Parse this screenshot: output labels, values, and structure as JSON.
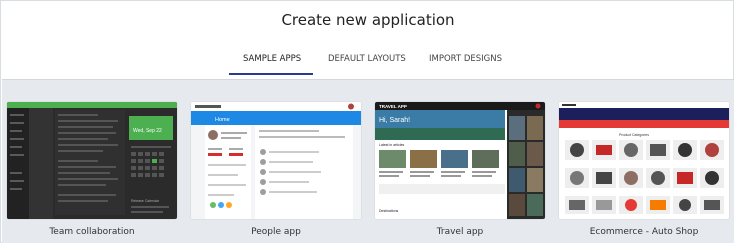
{
  "page": {
    "title": "Create new application"
  },
  "tabs": [
    {
      "label": "SAMPLE APPS",
      "active": true
    },
    {
      "label": "DEFAULT LAYOUTS",
      "active": false
    },
    {
      "label": "IMPORT DESIGNS",
      "active": false
    }
  ],
  "apps": [
    {
      "caption": "Team collaboration",
      "screen": {
        "date_label": "Wed, Sep 22",
        "calendar_label": "Release Calendar"
      }
    },
    {
      "caption": "People app",
      "screen": {
        "header_title": "Home"
      }
    },
    {
      "caption": "Travel app",
      "screen": {
        "app_title": "TRAVEL APP",
        "greeting": "Hi, Sarah!",
        "section_latest": "Latest in articles",
        "section_destinations": "Destinations"
      }
    },
    {
      "caption": "Ecommerce - Auto Shop",
      "screen": {
        "section_title": "Product Categories"
      }
    }
  ],
  "colors": {
    "tab_underline": "#2b3a8e",
    "team_accent": "#4caf50",
    "people_blue": "#1e88e5",
    "travel_dark": "#1a1a1a",
    "shop_navy": "#1b1f5c",
    "shop_accent": "#e53935"
  }
}
